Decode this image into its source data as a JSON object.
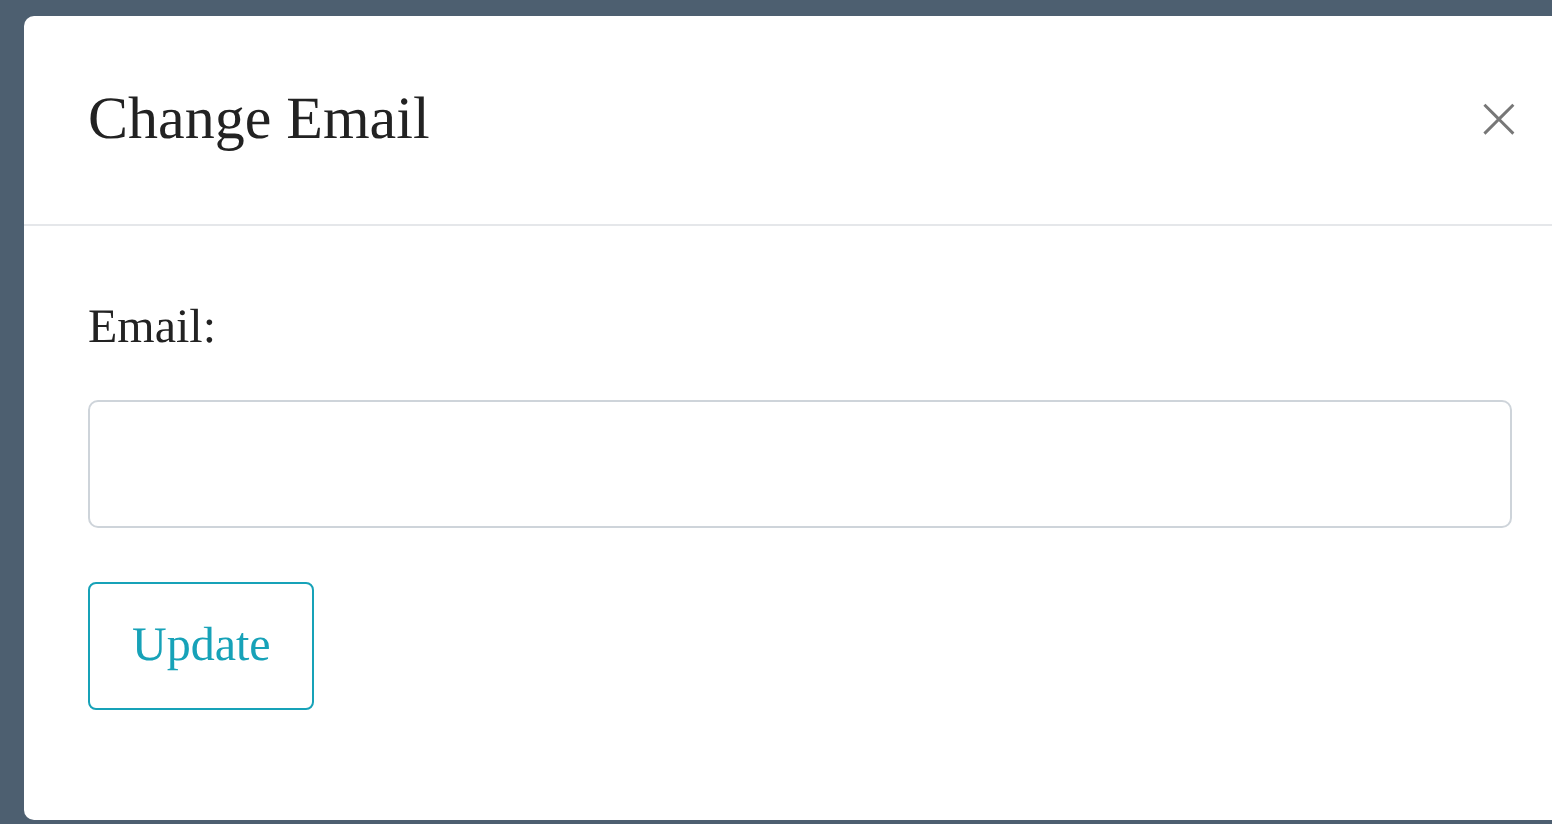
{
  "dialog": {
    "title": "Change Email",
    "close": "×"
  },
  "form": {
    "label": "Email:"
  },
  "buttons": [
    "Update"
  ]
}
